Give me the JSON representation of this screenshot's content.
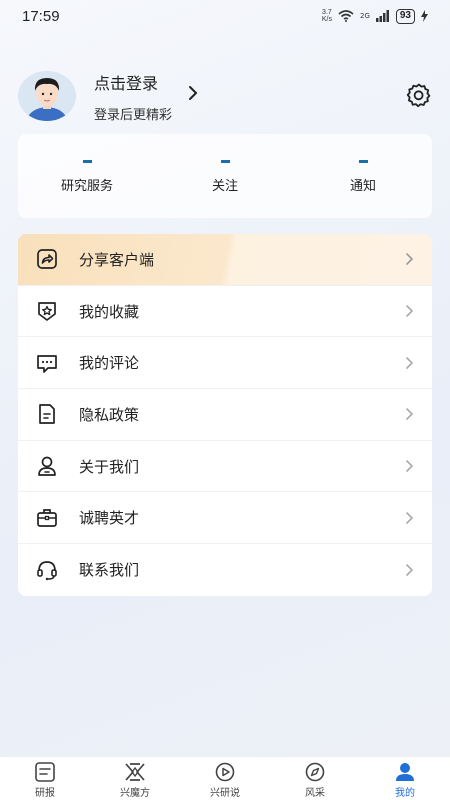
{
  "status_bar": {
    "time": "17:59",
    "net_speed_value": "3.7",
    "net_speed_unit": "K/s",
    "signal_label": "2G",
    "battery": "93"
  },
  "profile": {
    "login_title": "点击登录",
    "login_subtitle": "登录后更精彩"
  },
  "stats": [
    {
      "value": "–",
      "label": "研究服务"
    },
    {
      "value": "–",
      "label": "关注"
    },
    {
      "value": "–",
      "label": "通知"
    }
  ],
  "menu": [
    {
      "label": "分享客户端",
      "icon": "share-icon"
    },
    {
      "label": "我的收藏",
      "icon": "favorite-star-icon"
    },
    {
      "label": "我的评论",
      "icon": "comment-icon"
    },
    {
      "label": "隐私政策",
      "icon": "document-icon"
    },
    {
      "label": "关于我们",
      "icon": "user-icon"
    },
    {
      "label": "诚聘英才",
      "icon": "briefcase-icon"
    },
    {
      "label": "联系我们",
      "icon": "headset-icon"
    }
  ],
  "tabs": [
    {
      "label": "研报",
      "icon": "report-icon"
    },
    {
      "label": "兴魔方",
      "icon": "cube-logo-icon"
    },
    {
      "label": "兴研说",
      "icon": "play-icon"
    },
    {
      "label": "风采",
      "icon": "compass-icon"
    },
    {
      "label": "我的",
      "icon": "profile-icon"
    }
  ],
  "colors": {
    "accent": "#1f6fd6",
    "stat_dash": "#1a6fa8",
    "highlight_start": "#f9e0bb"
  }
}
